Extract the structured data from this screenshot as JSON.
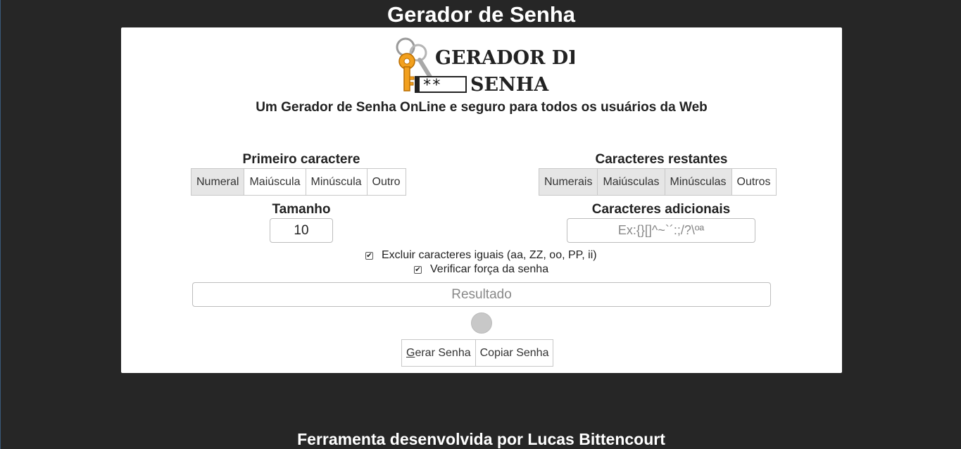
{
  "header": {
    "title": "Gerador de Senha"
  },
  "logo": {
    "line1": "GERADOR DE",
    "line2": "SENHA",
    "field_text": "**"
  },
  "subtitle": "Um Gerador de Senha OnLine e seguro para todos os usuários da Web",
  "first_char": {
    "title": "Primeiro caractere",
    "options": [
      {
        "label": "Numeral",
        "active": true
      },
      {
        "label": "Maiúscula",
        "active": false
      },
      {
        "label": "Minúscula",
        "active": false
      },
      {
        "label": "Outro",
        "active": false
      }
    ]
  },
  "remaining_chars": {
    "title": "Caracteres restantes",
    "options": [
      {
        "label": "Numerais",
        "active": true
      },
      {
        "label": "Maiúsculas",
        "active": true
      },
      {
        "label": "Minúsculas",
        "active": true
      },
      {
        "label": "Outros",
        "active": false
      }
    ]
  },
  "size": {
    "label": "Tamanho",
    "value": "10"
  },
  "extra_chars": {
    "label": "Caracteres adicionais",
    "placeholder": "Ex:{}[]^~`´:;/?\\ºª"
  },
  "options": {
    "exclude_repeats": {
      "label": "Excluir caracteres iguais (aa, ZZ, oo, PP, ii)",
      "checked": true
    },
    "check_strength": {
      "label": "Verificar força da senha",
      "checked": true
    }
  },
  "result": {
    "placeholder": "Resultado"
  },
  "actions": {
    "generate_label_key": "G",
    "generate_label_rest": "erar Senha",
    "copy_label": "Copiar Senha"
  },
  "footer": {
    "text": "Ferramenta desenvolvida por Lucas Bittencourt"
  },
  "colors": {
    "page_bg": "#262626",
    "card_bg": "#ffffff",
    "active_seg": "#e6e6e6",
    "logo_key": "#f2a01e"
  }
}
